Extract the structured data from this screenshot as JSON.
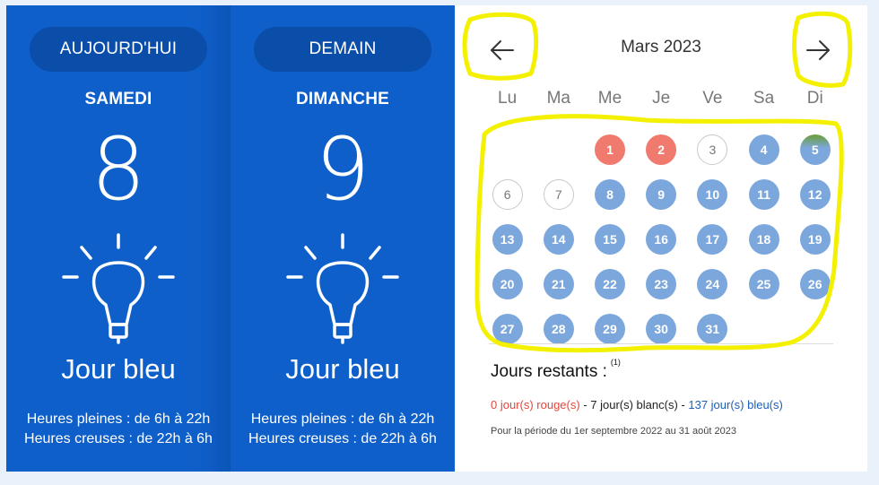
{
  "today": {
    "badge": "AUJOURD'HUI",
    "day_name": "SAMEDI",
    "day_number": "8",
    "label": "Jour bleu",
    "hours_full": "Heures pleines : de 6h à 22h",
    "hours_off": "Heures creuses : de 22h à 6h"
  },
  "tomorrow": {
    "badge": "DEMAIN",
    "day_name": "DIMANCHE",
    "day_number": "9",
    "label": "Jour bleu",
    "hours_full": "Heures pleines : de 6h à 22h",
    "hours_off": "Heures creuses : de 22h à 6h"
  },
  "calendar": {
    "month_label": "Mars 2023",
    "weekdays": [
      "Lu",
      "Ma",
      "Me",
      "Je",
      "Ve",
      "Sa",
      "Di"
    ],
    "days": [
      {
        "n": "1",
        "type": "rouge"
      },
      {
        "n": "2",
        "type": "rouge"
      },
      {
        "n": "3",
        "type": "blanc"
      },
      {
        "n": "4",
        "type": "bleu"
      },
      {
        "n": "5",
        "type": "bleu"
      },
      {
        "n": "6",
        "type": "blanc"
      },
      {
        "n": "7",
        "type": "blanc"
      },
      {
        "n": "8",
        "type": "bleu"
      },
      {
        "n": "9",
        "type": "bleu"
      },
      {
        "n": "10",
        "type": "bleu"
      },
      {
        "n": "11",
        "type": "bleu"
      },
      {
        "n": "12",
        "type": "bleu"
      },
      {
        "n": "13",
        "type": "bleu"
      },
      {
        "n": "14",
        "type": "bleu"
      },
      {
        "n": "15",
        "type": "bleu"
      },
      {
        "n": "16",
        "type": "bleu"
      },
      {
        "n": "17",
        "type": "bleu"
      },
      {
        "n": "18",
        "type": "bleu"
      },
      {
        "n": "19",
        "type": "bleu"
      },
      {
        "n": "20",
        "type": "bleu"
      },
      {
        "n": "21",
        "type": "bleu"
      },
      {
        "n": "22",
        "type": "bleu"
      },
      {
        "n": "23",
        "type": "bleu"
      },
      {
        "n": "24",
        "type": "bleu"
      },
      {
        "n": "25",
        "type": "bleu"
      },
      {
        "n": "26",
        "type": "bleu"
      },
      {
        "n": "27",
        "type": "bleu"
      },
      {
        "n": "28",
        "type": "bleu"
      },
      {
        "n": "29",
        "type": "bleu"
      },
      {
        "n": "30",
        "type": "bleu"
      },
      {
        "n": "31",
        "type": "bleu"
      }
    ]
  },
  "remaining": {
    "title": "Jours restants :",
    "footnote": "(1)",
    "rouge": "0 jour(s) rouge(s)",
    "sep1": " - ",
    "blanc": "7 jour(s) blanc(s)",
    "sep2": " - ",
    "bleu": "137 jour(s) bleu(s)",
    "period": "Pour la période du 1er septembre 2022 au 31 août 2023"
  },
  "icons": {
    "prev": "arrow-left-icon",
    "next": "arrow-right-icon",
    "bulb": "lightbulb-icon"
  },
  "colors": {
    "card_blue": "#0f5fca",
    "pill_blue": "#0a4ea9",
    "day_blue": "#7ca7dd",
    "day_red": "#f07a6d",
    "highlight": "#f4f100"
  }
}
